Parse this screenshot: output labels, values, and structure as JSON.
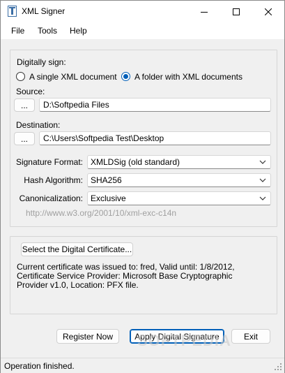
{
  "window": {
    "title": "XML Signer"
  },
  "menu": {
    "items": [
      "File",
      "Tools",
      "Help"
    ]
  },
  "sign": {
    "group_label": "Digitally sign:",
    "options": [
      {
        "label": "A single XML document",
        "checked": false
      },
      {
        "label": "A folder with XML documents",
        "checked": true
      }
    ],
    "source_label": "Source:",
    "source_browse": "...",
    "source_value": "D:\\Softpedia Files",
    "destination_label": "Destination:",
    "destination_browse": "...",
    "destination_value": "C:\\Users\\Softpedia Test\\Desktop",
    "signature_format_label": "Signature Format:",
    "signature_format_value": "XMLDSig (old standard)",
    "hash_algorithm_label": "Hash Algorithm:",
    "hash_algorithm_value": "SHA256",
    "canonicalization_label": "Canonicalization:",
    "canonicalization_value": "Exclusive",
    "canonicalization_url": "http://www.w3.org/2001/10/xml-exc-c14n"
  },
  "certificate": {
    "select_button": "Select the Digital Certificate...",
    "info": "Current certificate was issued to: fred, Valid until: 1/8/2012, Certificate Service Provider: Microsoft Base Cryptographic Provider v1.0, Location: PFX file."
  },
  "actions": {
    "register": "Register Now",
    "apply": "Apply Digital Signature",
    "exit": "Exit"
  },
  "status": {
    "text": "Operation finished."
  },
  "watermark": "SOFTPEDIA",
  "colors": {
    "accent": "#005fb8",
    "window_bg": "#f0f0f0",
    "hint_text": "#a0a0a0"
  }
}
